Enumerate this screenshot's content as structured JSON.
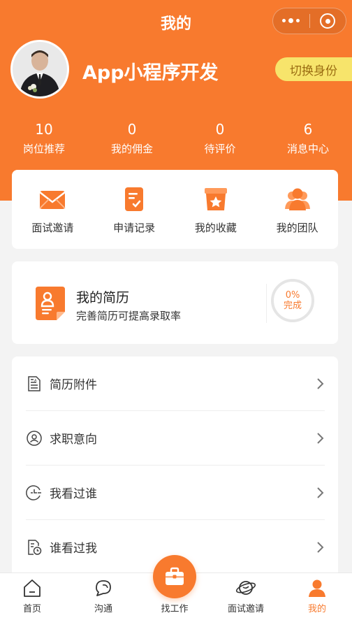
{
  "header": {
    "title": "我的"
  },
  "profile": {
    "name": "App小程序开发",
    "switch_label": "切换身份"
  },
  "stats": [
    {
      "num": "10",
      "label": "岗位推荐"
    },
    {
      "num": "0",
      "label": "我的佣金"
    },
    {
      "num": "0",
      "label": "待评价"
    },
    {
      "num": "6",
      "label": "消息中心"
    }
  ],
  "quick": [
    {
      "label": "面试邀请",
      "icon": "envelope-icon"
    },
    {
      "label": "申请记录",
      "icon": "clipboard-icon"
    },
    {
      "label": "我的收藏",
      "icon": "star-box-icon"
    },
    {
      "label": "我的团队",
      "icon": "team-icon"
    }
  ],
  "resume": {
    "title": "我的简历",
    "subtitle": "完善简历可提高录取率",
    "percent": "0%",
    "status": "完成"
  },
  "menu": [
    {
      "label": "简历附件",
      "icon": "attachment-doc-icon"
    },
    {
      "label": "求职意向",
      "icon": "job-intent-icon"
    },
    {
      "label": "我看过谁",
      "icon": "viewed-icon"
    },
    {
      "label": "谁看过我",
      "icon": "visitors-icon"
    }
  ],
  "tabbar": {
    "home": "首页",
    "chat": "沟通",
    "jobs": "找工作",
    "interview": "面试邀请",
    "mine": "我的"
  },
  "colors": {
    "accent": "#f87a2e",
    "switch_bg": "#f7e46b"
  }
}
